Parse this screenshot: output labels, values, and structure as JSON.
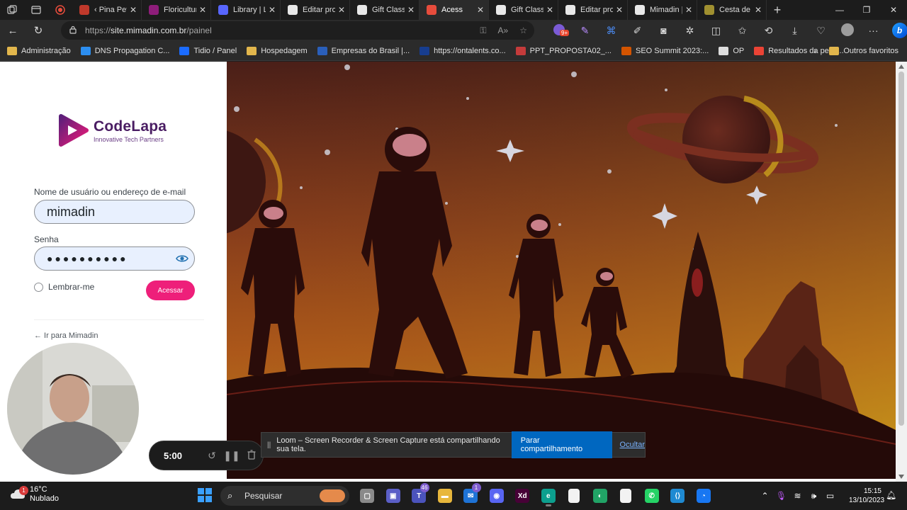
{
  "browser": {
    "tabs": [
      {
        "label": "‹ Pina Peti",
        "color": "#c0392b",
        "active": false
      },
      {
        "label": "Floricultur",
        "color": "#8e1d7a",
        "active": false
      },
      {
        "label": "Library | Lo",
        "color": "#5866ff",
        "active": false
      },
      {
        "label": "Editar pro",
        "color": "#e8e8e8",
        "active": false
      },
      {
        "label": "Gift Classi",
        "color": "#e8e8e8",
        "active": false
      },
      {
        "label": "Acess",
        "color": "#e74c3c",
        "active": true
      },
      {
        "label": "Gift Classi",
        "color": "#e8e8e8",
        "active": false
      },
      {
        "label": "Editar pro",
        "color": "#e8e8e8",
        "active": false
      },
      {
        "label": "Mimadin |",
        "color": "#e8e8e8",
        "active": false
      },
      {
        "label": "Cesta de c",
        "color": "#a09030",
        "active": false
      }
    ],
    "url_prefix": "https://",
    "url_host": "site.mimadin.com.br",
    "url_path": "/painel",
    "extension_badge": "9+",
    "bookmarks": [
      {
        "label": "Administração",
        "type": "folder"
      },
      {
        "label": "DNS Propagation C...",
        "type": "site",
        "color": "#2c8ef0"
      },
      {
        "label": "Tidio / Panel",
        "type": "site",
        "color": "#1b6bff"
      },
      {
        "label": "Hospedagem",
        "type": "folder"
      },
      {
        "label": "Empresas do Brasil |...",
        "type": "site",
        "color": "#2a5fba"
      },
      {
        "label": "https://ontalents.co...",
        "type": "site",
        "color": "#173d8f"
      },
      {
        "label": "PPT_PROPOSTA02_...",
        "type": "site",
        "color": "#c43b3b"
      },
      {
        "label": "SEO Summit 2023:...",
        "type": "site",
        "color": "#d35400"
      },
      {
        "label": "OP",
        "type": "site",
        "color": "#dddddd"
      },
      {
        "label": "Resultados da pesq...",
        "type": "site",
        "color": "#ea4335"
      }
    ],
    "other_favorites": "Outros favoritos"
  },
  "login": {
    "brand_name": "CodeLapa",
    "brand_tagline": "Innovative Tech Partners",
    "username_label": "Nome de usuário ou endereço de e-mail",
    "username_value": "mimadin",
    "password_label": "Senha",
    "password_value": "●●●●●●●●●●",
    "remember_label": "Lembrar-me",
    "submit_label": "Acessar",
    "back_link": "← Ir para Mimadin"
  },
  "recorder": {
    "timer": "5:00",
    "share_message": "Loom – Screen Recorder & Screen Capture está compartilhando sua tela.",
    "stop_label": "Parar compartilhamento",
    "hide_label": "Ocultar"
  },
  "taskbar": {
    "temperature": "16°C",
    "condition": "Nublado",
    "weather_badge": "1",
    "search_placeholder": "Pesquisar",
    "apps": [
      {
        "name": "task-view",
        "color": "#8a8a8a",
        "glyph": "▢",
        "badge": ""
      },
      {
        "name": "teams-chat",
        "color": "#5b5fc7",
        "glyph": "▣",
        "badge": ""
      },
      {
        "name": "teams",
        "color": "#4b53bc",
        "glyph": "T",
        "badge": "46"
      },
      {
        "name": "file-explorer",
        "color": "#e8b73c",
        "glyph": "▬",
        "badge": ""
      },
      {
        "name": "mail",
        "color": "#1e73d6",
        "glyph": "✉",
        "badge": "1"
      },
      {
        "name": "discord",
        "color": "#5865f2",
        "glyph": "◉",
        "badge": ""
      },
      {
        "name": "adobe-xd",
        "color": "#470137",
        "glyph": "Xd",
        "badge": ""
      },
      {
        "name": "edge",
        "color": "#0c9f8e",
        "glyph": "e",
        "badge": ""
      },
      {
        "name": "document",
        "color": "#f2f2f2",
        "glyph": "",
        "badge": ""
      },
      {
        "name": "green-app",
        "color": "#21a366",
        "glyph": "◐",
        "badge": ""
      },
      {
        "name": "document-2",
        "color": "#f2f2f2",
        "glyph": "",
        "badge": ""
      },
      {
        "name": "whatsapp",
        "color": "#25d366",
        "glyph": "✆",
        "badge": ""
      },
      {
        "name": "vscode",
        "color": "#1f8ad2",
        "glyph": "⟨⟩",
        "badge": ""
      },
      {
        "name": "messenger",
        "color": "#1877f2",
        "glyph": "◔",
        "badge": ""
      }
    ],
    "time": "15:15",
    "date": "13/10/2023"
  }
}
